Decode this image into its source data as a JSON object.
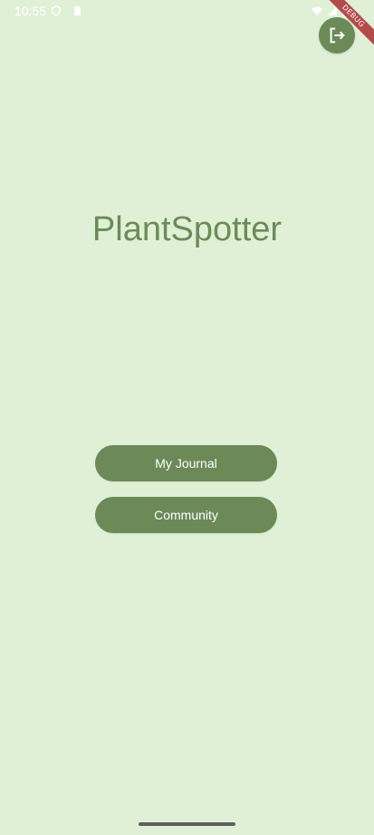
{
  "status_bar": {
    "time": "10:55",
    "icons": [
      "shield-icon",
      "sim-card-icon",
      "wifi-icon",
      "signal-icon",
      "battery-icon"
    ]
  },
  "app": {
    "title": "PlantSpotter",
    "logout_icon": "logout-icon",
    "debug_label": "DEBUG"
  },
  "buttons": {
    "journal_label": "My Journal",
    "community_label": "Community"
  },
  "colors": {
    "background": "#e0f0d6",
    "accent": "#6b8a58",
    "title": "#6a8c58"
  }
}
